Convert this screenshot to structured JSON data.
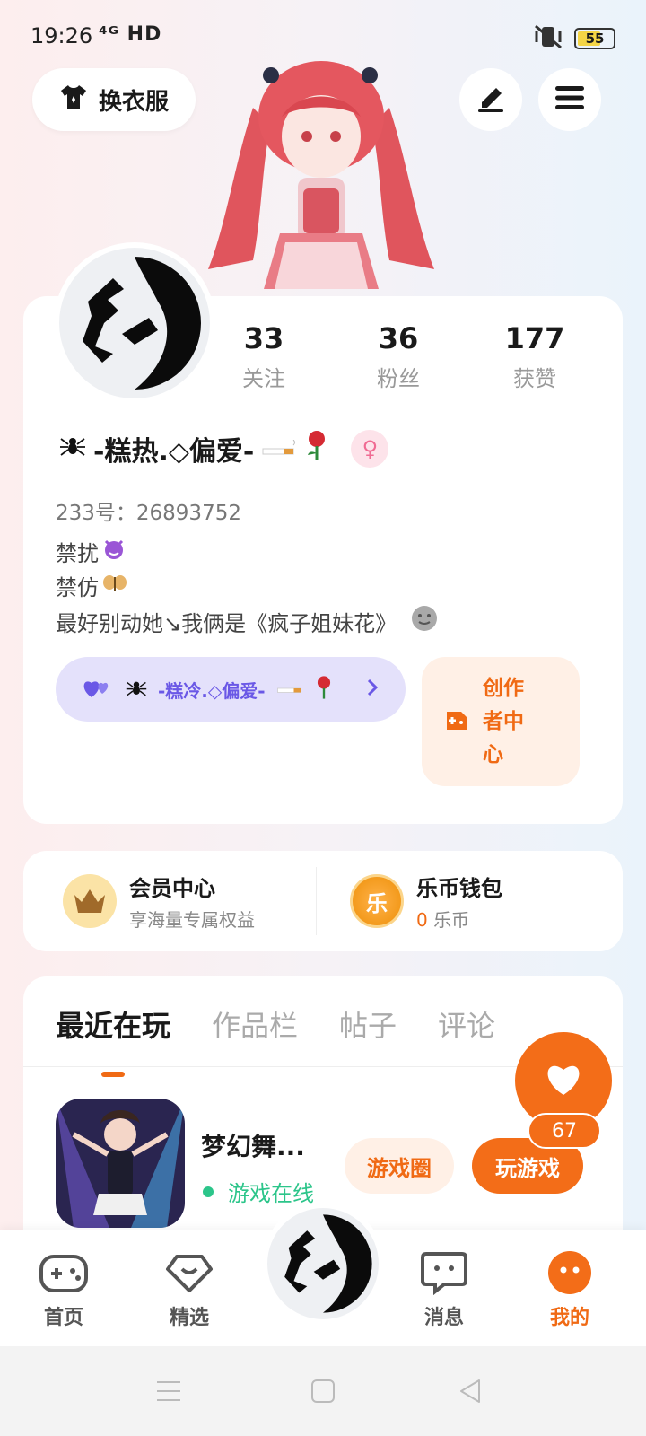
{
  "status_bar": {
    "time": "19:26",
    "network": "⁴ᴳ HD",
    "battery": "55"
  },
  "header": {
    "outfit_label": "换衣服"
  },
  "stats": [
    {
      "value": "33",
      "label": "关注"
    },
    {
      "value": "36",
      "label": "粉丝"
    },
    {
      "value": "177",
      "label": "获赞"
    }
  ],
  "profile": {
    "nickname": "-糕热.◇偏爱-",
    "uid": "233号：26893752",
    "bio": [
      "禁扰",
      "禁仿",
      "最好别动她↘我俩是《疯子姐妹花》"
    ]
  },
  "cp": {
    "name": "-糕冷.◇偏爱-"
  },
  "creator": {
    "label": "创作者中心"
  },
  "wallet": {
    "member_title": "会员中心",
    "member_sub": "享海量专属权益",
    "coin_title": "乐币钱包",
    "coin_amount": "0",
    "coin_unit": "乐币",
    "coin_icon": "乐"
  },
  "tabs": [
    "最近在玩",
    "作品栏",
    "帖子",
    "评论"
  ],
  "game": {
    "name": "梦幻舞...",
    "status": "游戏在线",
    "circle_btn": "游戏圈",
    "play_btn": "玩游戏"
  },
  "like_count": "67",
  "bottom_nav": [
    {
      "label": "首页",
      "icon": "gamepad-icon"
    },
    {
      "label": "精选",
      "icon": "heart-badge-icon"
    },
    {
      "label": "消息",
      "icon": "chat-icon"
    },
    {
      "label": "我的",
      "icon": "smile-icon"
    }
  ],
  "colors": {
    "accent": "#f36d18",
    "cp_purple": "#6a58e6",
    "online_green": "#2cc58a"
  }
}
